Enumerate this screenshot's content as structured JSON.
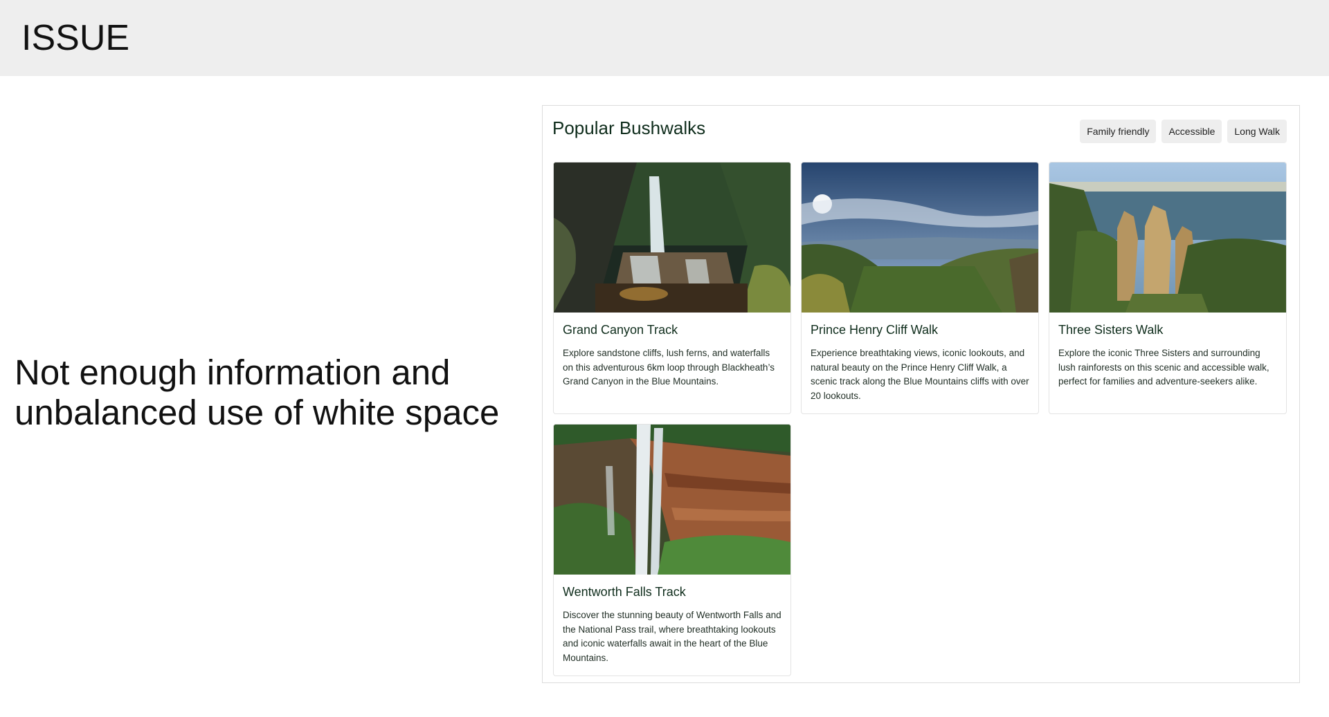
{
  "header": {
    "title": "ISSUE"
  },
  "issue": {
    "description": "Not enough information and unbalanced use of white space"
  },
  "panel": {
    "title": "Popular Bushwalks",
    "filters": [
      "Family friendly",
      "Accessible",
      "Long Walk"
    ]
  },
  "cards": [
    {
      "title": "Grand Canyon Track",
      "description": "Explore sandstone cliffs, lush ferns, and waterfalls on this adventurous 6km loop through Blackheath’s Grand Canyon in the Blue Mountains.",
      "image": "waterfall-canyon-photo"
    },
    {
      "title": "Prince Henry Cliff Walk",
      "description": "Experience breathtaking views, iconic lookouts, and natural beauty on the Prince Henry Cliff Walk, a scenic track along the Blue Mountains cliffs with over 20 lookouts.",
      "image": "mountain-valley-panorama-photo"
    },
    {
      "title": "Three Sisters Walk",
      "description": "Explore the iconic Three Sisters and surrounding lush rainforests on this scenic and accessible walk, perfect for families and adventure-seekers alike.",
      "image": "three-sisters-rock-formation-photo"
    },
    {
      "title": "Wentworth Falls Track",
      "description": "Discover the stunning beauty of Wentworth Falls and the National Pass trail, where breathtaking lookouts and iconic waterfalls await in the heart of the Blue Mountains.",
      "image": "wentworth-falls-cliff-photo"
    }
  ]
}
